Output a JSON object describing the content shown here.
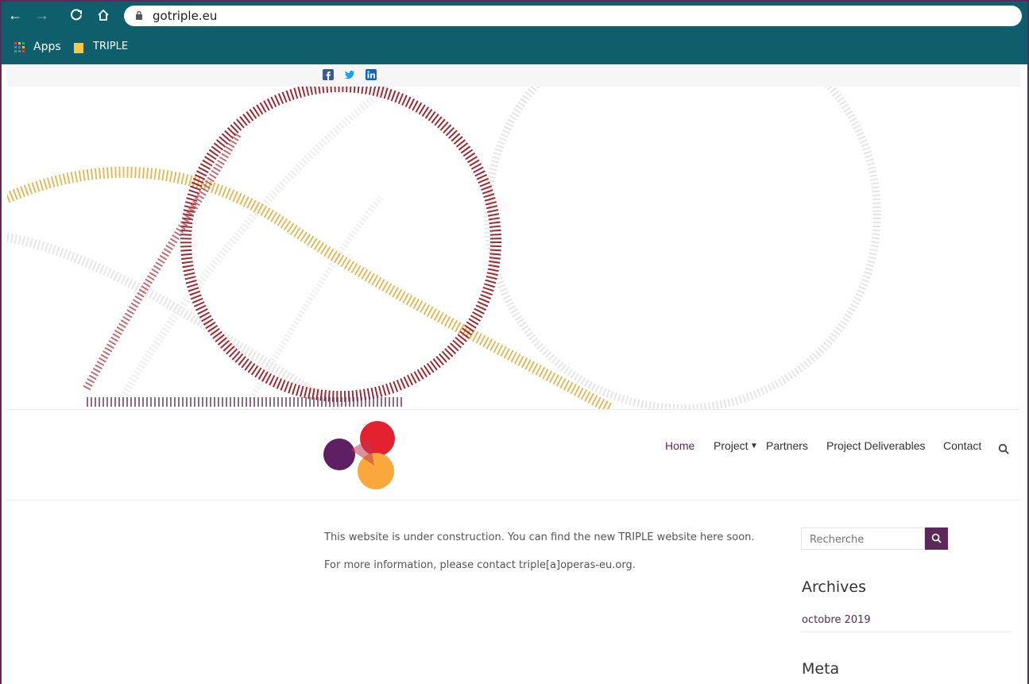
{
  "browser": {
    "url": "gotriple.eu",
    "bookmarks": [
      {
        "label": "Apps",
        "icon": "apps-grid-icon"
      },
      {
        "label": "TRIPLE",
        "icon": "folder-icon"
      }
    ]
  },
  "social": {
    "items": [
      {
        "name": "facebook-icon"
      },
      {
        "name": "twitter-icon"
      },
      {
        "name": "linkedin-icon"
      }
    ]
  },
  "nav": {
    "items": [
      "Home",
      "Project",
      "Partners",
      "Project Deliverables",
      "Contact"
    ]
  },
  "content": {
    "paragraphs": [
      "This website is under construction. You can find the new TRIPLE website here soon.",
      "For more information, please contact triple[a]operas-eu.org."
    ]
  },
  "sidebar": {
    "search_placeholder": "Recherche",
    "archives_title": "Archives",
    "archive_link": "octobre 2019",
    "meta_title": "Meta"
  },
  "colors": {
    "browser_bar": "#0e5f6b",
    "brand_purple": "#5b2a5b",
    "logo_red": "#e3212f",
    "logo_orange": "#f9a93c",
    "logo_purple": "#5e1f63"
  }
}
